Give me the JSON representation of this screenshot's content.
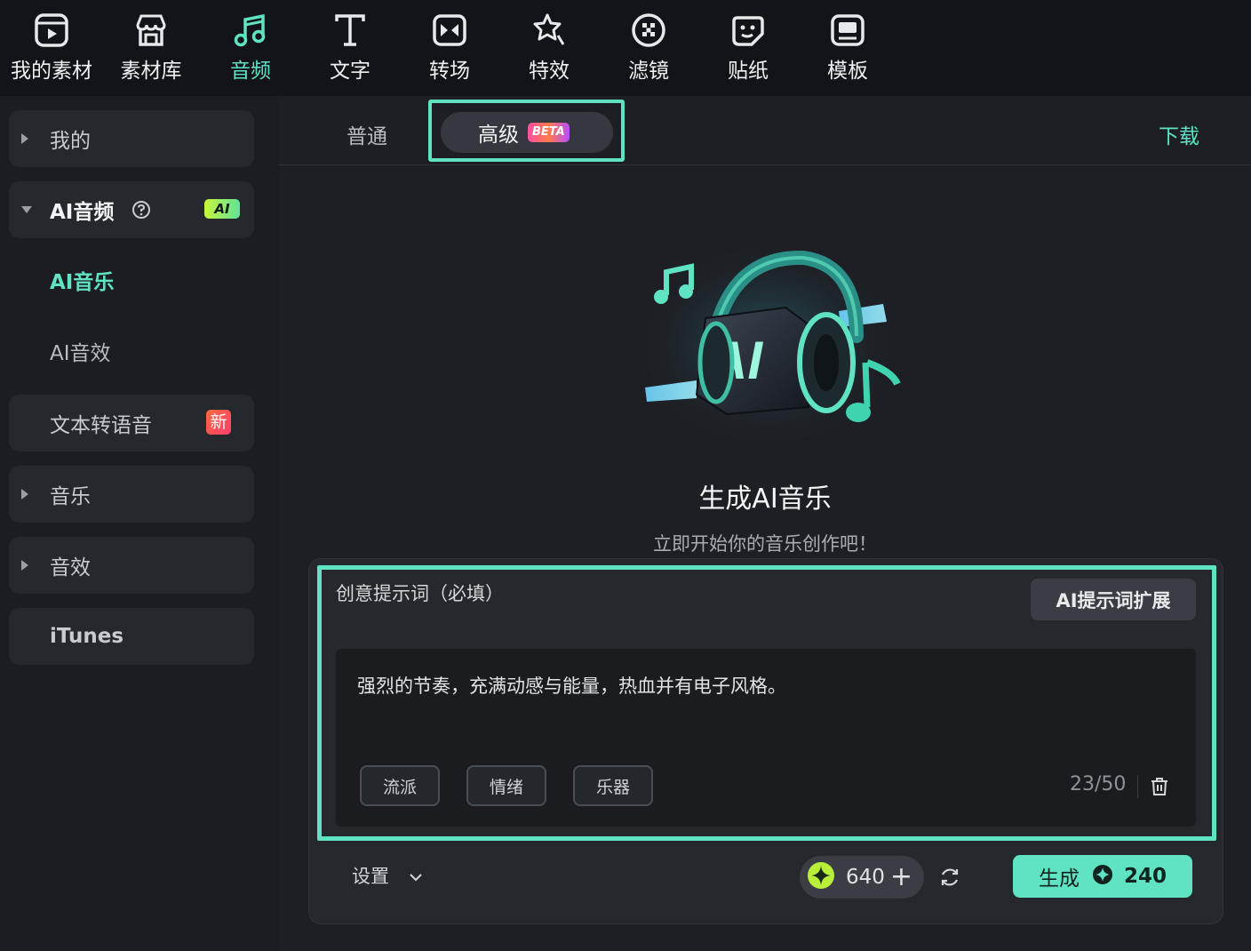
{
  "toolbar": {
    "items": [
      {
        "label": "我的素材",
        "icon": "media-icon"
      },
      {
        "label": "素材库",
        "icon": "store-icon"
      },
      {
        "label": "音频",
        "icon": "music-note-icon",
        "active": true
      },
      {
        "label": "文字",
        "icon": "text-icon"
      },
      {
        "label": "转场",
        "icon": "transition-icon"
      },
      {
        "label": "特效",
        "icon": "effects-icon"
      },
      {
        "label": "滤镜",
        "icon": "filter-icon"
      },
      {
        "label": "贴纸",
        "icon": "sticker-icon"
      },
      {
        "label": "模板",
        "icon": "template-icon"
      }
    ]
  },
  "sidebar": {
    "mine": "我的",
    "ai_audio": "AI音频",
    "ai_badge": "AI",
    "ai_music": "AI音乐",
    "ai_sfx": "AI音效",
    "tts": "文本转语音",
    "new_badge": "新",
    "music": "音乐",
    "sfx": "音效",
    "itunes": "iTunes"
  },
  "tabs": {
    "normal": "普通",
    "advanced": "高级",
    "beta": "BETA",
    "download": "下载"
  },
  "hero": {
    "title": "生成AI音乐",
    "subtitle": "立即开始你的音乐创作吧！",
    "art_text": "AI"
  },
  "prompt": {
    "label": "创意提示词（必填）",
    "expand_button": "AI提示词扩展",
    "value": "强烈的节奏，充满动感与能量，热血并有电子风格。",
    "chips": [
      "流派",
      "情绪",
      "乐器"
    ],
    "count": "23/50"
  },
  "footer": {
    "settings": "设置",
    "credits": "640",
    "plus": "+",
    "generate": "生成",
    "generate_cost": "240"
  },
  "colors": {
    "accent": "#5fe3c2",
    "background": "#1d1f24",
    "toolbar_bg": "#121419"
  }
}
